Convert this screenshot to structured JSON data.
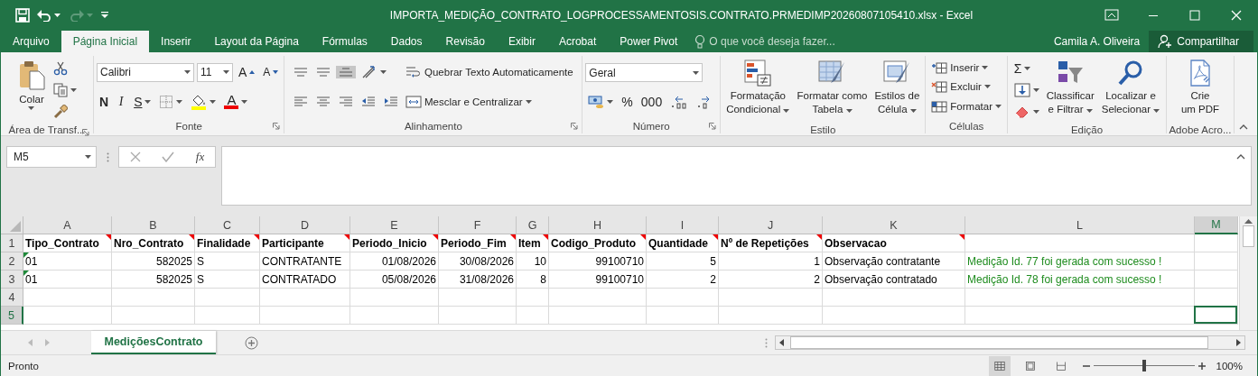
{
  "window": {
    "title": "IMPORTA_MEDIÇÃO_CONTRATO_LOGPROCESSAMENTOSIS.CONTRATO.PRMEDIMP20260807105410.xlsx - Excel",
    "redo_disabled": true
  },
  "tabs": [
    {
      "label": "Arquivo",
      "selected": false
    },
    {
      "label": "Página Inicial",
      "selected": true
    },
    {
      "label": "Inserir",
      "selected": false
    },
    {
      "label": "Layout da Página",
      "selected": false
    },
    {
      "label": "Fórmulas",
      "selected": false
    },
    {
      "label": "Dados",
      "selected": false
    },
    {
      "label": "Revisão",
      "selected": false
    },
    {
      "label": "Exibir",
      "selected": false
    },
    {
      "label": "Acrobat",
      "selected": false
    },
    {
      "label": "Power Pivot",
      "selected": false
    }
  ],
  "tell_me": {
    "placeholder": "O que você deseja fazer..."
  },
  "user": "Camila A. Oliveira",
  "share_button": "Compartilhar",
  "ribbon": [
    {
      "label": "Área de Transf...",
      "launcher": true,
      "columns": [
        [
          [
            {
              "kind": "large",
              "lines": [
                "Colar"
              ],
              "dropdown": true
            }
          ]
        ],
        [
          [
            {
              "kind": "icon"
            }
          ],
          [
            {
              "kind": "icon",
              "dropdown": true
            }
          ],
          [
            {
              "kind": "icon"
            }
          ]
        ]
      ]
    },
    {
      "label": "Fonte",
      "launcher": true,
      "columns": [
        [
          [
            {
              "kind": "combo",
              "value": "Calibri"
            },
            {
              "kind": "combo",
              "value": "11"
            },
            {
              "kind": "grow",
              "label": "A"
            },
            {
              "kind": "shrink",
              "label": "A"
            }
          ],
          [
            {
              "kind": "bold",
              "label": "N"
            },
            {
              "kind": "italic",
              "label": "I"
            },
            {
              "kind": "underline",
              "label": "S",
              "dropdown": true
            },
            {
              "kind": "icon",
              "dropdown": true
            },
            {
              "kind": "icon",
              "dropdown": true
            },
            {
              "kind": "fontcolor",
              "label": "A",
              "dropdown": true
            }
          ]
        ]
      ]
    },
    {
      "label": "Alinhamento",
      "launcher": true,
      "columns": [
        [
          [
            {
              "kind": "icon"
            },
            {
              "kind": "icon"
            },
            {
              "kind": "icon",
              "pressed": true
            },
            {
              "kind": "icon",
              "dropdown": true
            }
          ],
          [
            {
              "kind": "icon"
            },
            {
              "kind": "icon"
            },
            {
              "kind": "icon"
            },
            {
              "kind": "icon"
            },
            {
              "kind": "icon"
            }
          ]
        ],
        [
          [
            {
              "kind": "small",
              "label": "Quebrar Texto Automaticamente"
            }
          ],
          [
            {
              "kind": "small",
              "label": "Mesclar e Centralizar",
              "dropdown": true
            }
          ]
        ]
      ]
    },
    {
      "label": "Número",
      "launcher": true,
      "columns": [
        [
          [
            {
              "kind": "combo",
              "value": "Geral"
            }
          ],
          [
            {
              "kind": "icon",
              "dropdown": true
            },
            {
              "kind": "char",
              "label": "%"
            },
            {
              "kind": "char",
              "label": "000"
            },
            {
              "kind": "icon"
            },
            {
              "kind": "icon"
            }
          ]
        ]
      ]
    },
    {
      "label": "Estilo",
      "columns": [
        [
          [
            {
              "kind": "large",
              "lines": [
                "Formatação",
                "Condicional"
              ],
              "dropdown": true
            }
          ]
        ],
        [
          [
            {
              "kind": "large",
              "lines": [
                "Formatar como",
                "Tabela"
              ],
              "dropdown": true
            }
          ]
        ],
        [
          [
            {
              "kind": "large",
              "lines": [
                "Estilos de",
                "Célula"
              ],
              "dropdown": true
            }
          ]
        ]
      ]
    },
    {
      "label": "Células",
      "columns": [
        [
          [
            {
              "kind": "small",
              "label": "Inserir",
              "dropdown": true
            }
          ],
          [
            {
              "kind": "small",
              "label": "Excluir",
              "dropdown": true
            }
          ],
          [
            {
              "kind": "small",
              "label": "Formatar",
              "dropdown": true
            }
          ]
        ]
      ]
    },
    {
      "label": "Edição",
      "columns": [
        [
          [
            {
              "kind": "char",
              "label": "Σ",
              "dropdown": true
            }
          ],
          [
            {
              "kind": "icon",
              "dropdown": true
            }
          ],
          [
            {
              "kind": "icon",
              "dropdown": true
            }
          ]
        ],
        [
          [
            {
              "kind": "large",
              "lines": [
                "Classificar",
                "e Filtrar"
              ],
              "dropdown": true
            }
          ]
        ],
        [
          [
            {
              "kind": "large",
              "lines": [
                "Localizar e",
                "Selecionar"
              ],
              "dropdown": true
            }
          ]
        ]
      ]
    },
    {
      "label": "Adobe Acro...",
      "columns": [
        [
          [
            {
              "kind": "large",
              "lines": [
                "Crie",
                "um PDF"
              ]
            }
          ]
        ]
      ]
    }
  ],
  "formula_bar": {
    "name_box": "M5",
    "function_label": "fx"
  },
  "sheet": {
    "columns": [
      {
        "label": "A",
        "selected": false
      },
      {
        "label": "B",
        "selected": false
      },
      {
        "label": "C",
        "selected": false
      },
      {
        "label": "D",
        "selected": false
      },
      {
        "label": "E",
        "selected": false
      },
      {
        "label": "F",
        "selected": false
      },
      {
        "label": "G",
        "selected": false
      },
      {
        "label": "H",
        "selected": false
      },
      {
        "label": "I",
        "selected": false
      },
      {
        "label": "J",
        "selected": false
      },
      {
        "label": "K",
        "selected": false
      },
      {
        "label": "L",
        "selected": false
      },
      {
        "label": "M",
        "selected": true
      }
    ],
    "rows": [
      {
        "label": "1",
        "selected": false,
        "bold": true,
        "cells": [
          {
            "text": "Tipo_Contrato",
            "comment": true
          },
          {
            "text": "Nro_Contrato",
            "comment": true
          },
          {
            "text": "Finalidade",
            "comment": true
          },
          {
            "text": "Participante",
            "comment": true
          },
          {
            "text": "Periodo_Inicio",
            "comment": true
          },
          {
            "text": "Periodo_Fim",
            "comment": true
          },
          {
            "text": "Item",
            "comment": true
          },
          {
            "text": "Codigo_Produto",
            "comment": true
          },
          {
            "text": "Quantidade",
            "comment": true
          },
          {
            "text": "Nº de Repetições",
            "comment": true
          },
          {
            "text": "Observacao",
            "comment": true
          },
          {},
          {}
        ]
      },
      {
        "label": "2",
        "selected": false,
        "cells": [
          {
            "text": "01",
            "flag": true
          },
          {
            "text": "582025",
            "right_aligned": true
          },
          {
            "text": "S"
          },
          {
            "text": "CONTRATANTE"
          },
          {
            "text": "01/08/2026",
            "right_aligned": true
          },
          {
            "text": "30/08/2026",
            "right_aligned": true
          },
          {
            "text": "10",
            "right_aligned": true
          },
          {
            "text": "99100710",
            "right_aligned": true
          },
          {
            "text": "5",
            "right_aligned": true
          },
          {
            "text": "1",
            "right_aligned": true
          },
          {
            "text": "Observação contratante"
          },
          {
            "text": "Medição Id. 77 foi gerada com sucesso !",
            "color": "#1e8c1e"
          },
          {}
        ]
      },
      {
        "label": "3",
        "selected": false,
        "cells": [
          {
            "text": "01",
            "flag": true
          },
          {
            "text": "582025",
            "right_aligned": true
          },
          {
            "text": "S"
          },
          {
            "text": "CONTRATADO"
          },
          {
            "text": "05/08/2026",
            "right_aligned": true
          },
          {
            "text": "31/08/2026",
            "right_aligned": true
          },
          {
            "text": "8",
            "right_aligned": true
          },
          {
            "text": "99100710",
            "right_aligned": true
          },
          {
            "text": "2",
            "right_aligned": true
          },
          {
            "text": "2",
            "right_aligned": true
          },
          {
            "text": "Observação contratado"
          },
          {
            "text": "Medição Id. 78 foi gerada com sucesso !",
            "color": "#1e8c1e"
          },
          {}
        ]
      },
      {
        "label": "4",
        "selected": false
      },
      {
        "label": "5",
        "selected": true,
        "cells": [
          {},
          {},
          {},
          {},
          {},
          {},
          {},
          {},
          {},
          {},
          {},
          {},
          {
            "selected": true
          }
        ]
      }
    ]
  },
  "sheet_tabs": [
    {
      "label": "MediçõesContrato",
      "selected": true
    }
  ],
  "status_bar": {
    "text": "Pronto",
    "zoom": "100%",
    "zoom_slider": {
      "level": 0.5
    },
    "views": [
      {
        "selected": true
      },
      {
        "selected": false
      },
      {
        "selected": false
      }
    ]
  }
}
